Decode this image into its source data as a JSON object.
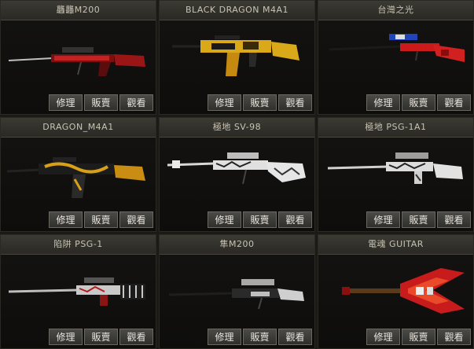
{
  "buttons": {
    "repair": "修理",
    "sell": "販賣",
    "view": "觀看"
  },
  "items": [
    {
      "name": "龘龘M200",
      "icon": "sniper-rifle-red-icon"
    },
    {
      "name": "BLACK DRAGON M4A1",
      "icon": "assault-rifle-gold-icon"
    },
    {
      "name": "台灣之光",
      "icon": "sniper-rifle-red-flag-icon"
    },
    {
      "name": "DRAGON_M4A1",
      "icon": "assault-rifle-dragon-icon"
    },
    {
      "name": "極地 SV-98",
      "icon": "sniper-rifle-arctic-icon"
    },
    {
      "name": "極地 PSG-1A1",
      "icon": "sniper-rifle-arctic-psg-icon"
    },
    {
      "name": "陷阱 PSG-1",
      "icon": "sniper-rifle-trap-icon"
    },
    {
      "name": "隼M200",
      "icon": "sniper-rifle-silver-icon"
    },
    {
      "name": "電魂 GUITAR",
      "icon": "electric-guitar-icon"
    }
  ]
}
